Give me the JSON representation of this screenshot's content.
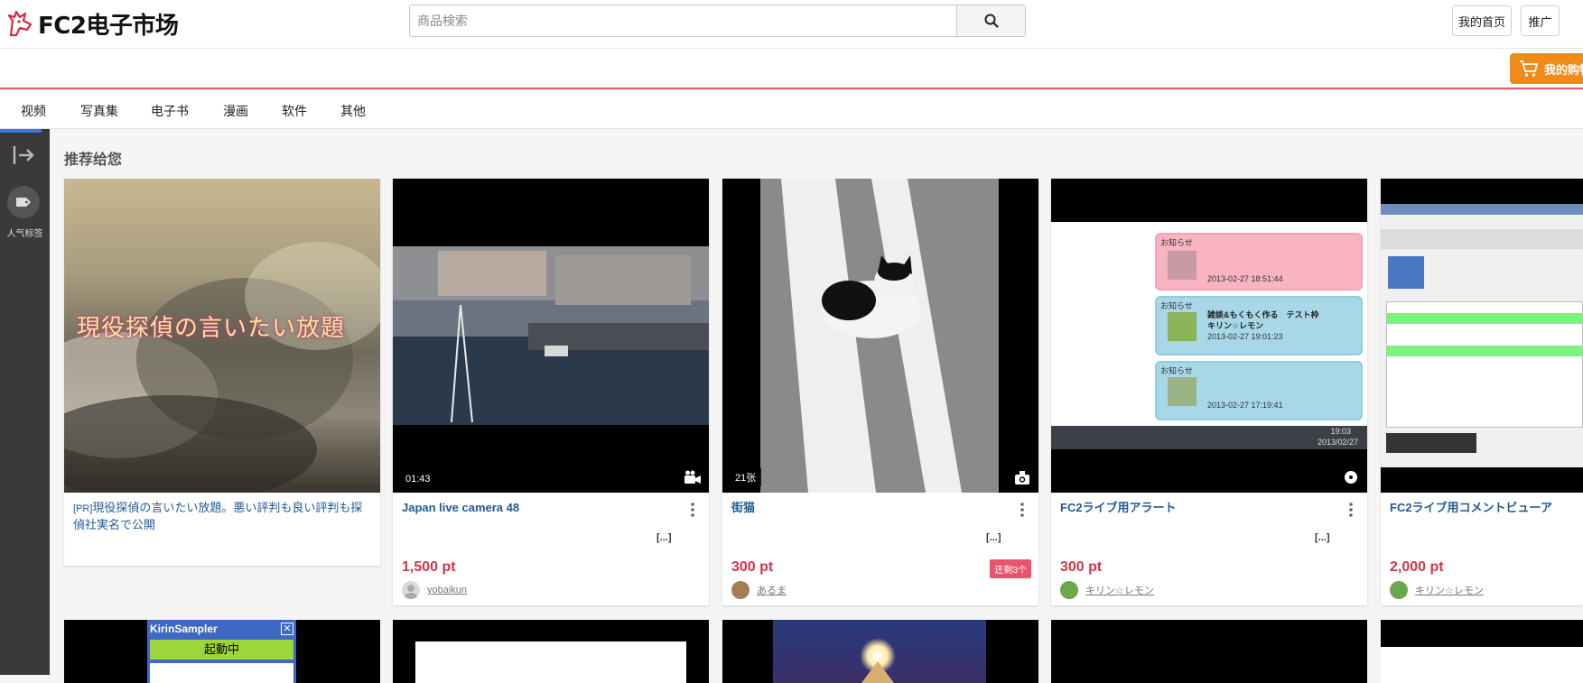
{
  "header": {
    "logo_text": "FC2电子市场",
    "search_placeholder": "商品検索",
    "my_home_label": "我的首页",
    "promote_label": "推广",
    "cart_label": "我的购物"
  },
  "nav": {
    "items": [
      "视频",
      "写真集",
      "电子书",
      "漫画",
      "软件",
      "其他"
    ]
  },
  "sidebar": {
    "tag_label": "人气标签"
  },
  "section": {
    "title": "推荐给您"
  },
  "cards": [
    {
      "pr_tag": "[PR]",
      "title": "現役探偵の言いたい放題。悪い評判も良い評判も探偵社実名で公開",
      "thumb_text": "現役探偵の言いたい放題"
    },
    {
      "title": "Japan live camera 48",
      "badge": "01:43",
      "more": "[...]",
      "price": "1,500 pt",
      "seller": "yobaikun",
      "media": "video-camera-icon"
    },
    {
      "title": "街猫",
      "badge": "21张",
      "more": "[...]",
      "price": "300 pt",
      "stock": "还剩3个",
      "seller": "あるま",
      "media": "photo-camera-icon"
    },
    {
      "title": "FC2ライブ用アラート",
      "more": "[...]",
      "price": "300 pt",
      "seller": "キリン☆レモン",
      "media": "disc-icon",
      "alerts": [
        "お知らせ",
        "お知らせ",
        "お知らせ"
      ],
      "alert_times": [
        "2013-02-27 18:51:44",
        "2013-02-27 19:01:23",
        "2013-02-27 17:19:41"
      ],
      "alert_msg": "雑談&もくもく作る　テスト枠",
      "alert_user": "キリン☆レモン",
      "clock_time": "19:03",
      "clock_date": "2013/02/27"
    },
    {
      "title": "FC2ライブ用コメントビューア",
      "price": "2,000 pt",
      "seller": "キリン☆レモン"
    }
  ],
  "row2": {
    "kirin_title": "KirinSampler",
    "kirin_status": "起動中"
  },
  "colors": {
    "accent_red": "#e8546b",
    "cart_orange": "#f08a19",
    "title_blue": "#1f5a99",
    "price_red": "#d2344b"
  }
}
